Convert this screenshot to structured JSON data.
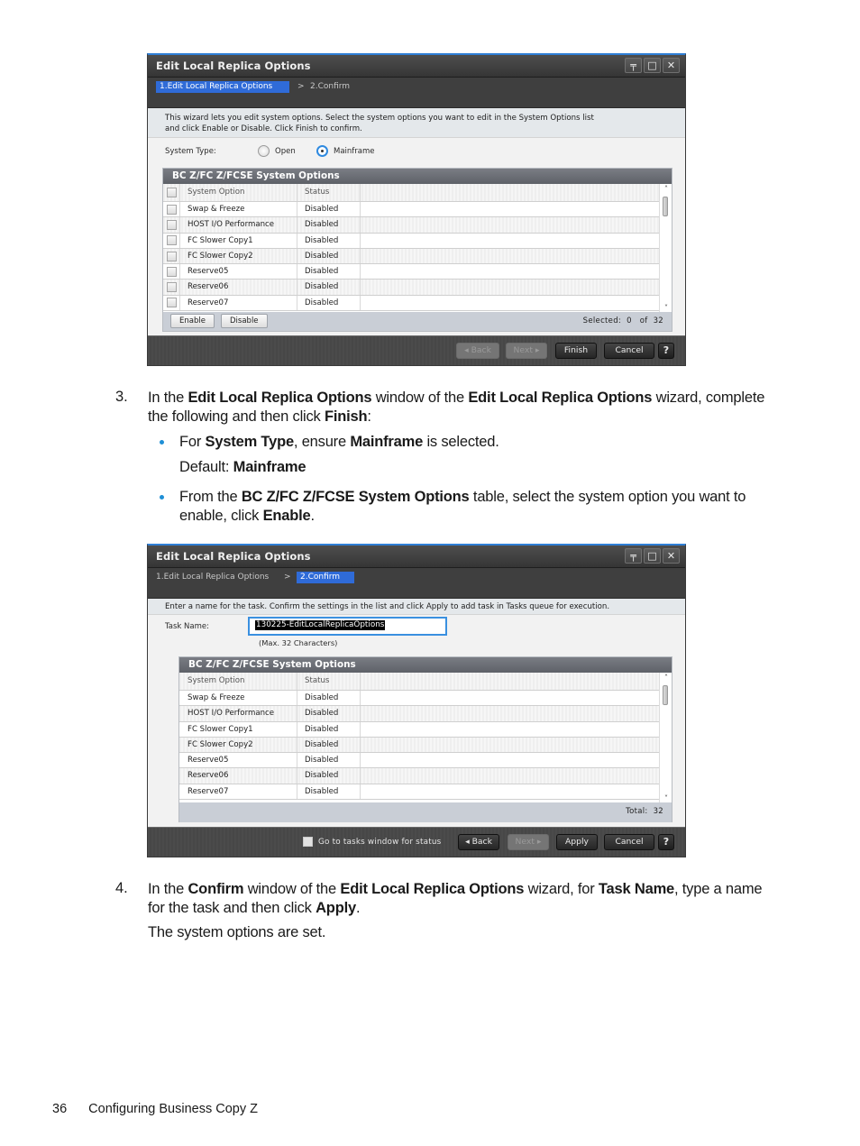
{
  "screens": {
    "edit": {
      "window_title": "Edit Local Replica Options",
      "window_buttons": [
        "pin-icon",
        "maximize-icon",
        "close-icon"
      ],
      "steps": [
        {
          "label": "1.Edit Local Replica Options",
          "active": true
        },
        {
          "label": "2.Confirm",
          "active": false
        }
      ],
      "step_separator": ">",
      "description_line1": "This wizard lets you edit system options. Select the system options you want to edit in the System Options list",
      "description_line2": "and click Enable or Disable. Click Finish to confirm.",
      "system_type_label": "System Type:",
      "system_type_options": [
        {
          "label": "Open",
          "selected": false
        },
        {
          "label": "Mainframe",
          "selected": true
        }
      ],
      "table_title": "BC Z/FC Z/FCSE System Options",
      "columns": [
        "System Option",
        "Status"
      ],
      "rows": [
        {
          "option": "Swap & Freeze",
          "status": "Disabled"
        },
        {
          "option": "HOST I/O Performance",
          "status": "Disabled"
        },
        {
          "option": "FC Slower Copy1",
          "status": "Disabled"
        },
        {
          "option": "FC Slower Copy2",
          "status": "Disabled"
        },
        {
          "option": "Reserve05",
          "status": "Disabled"
        },
        {
          "option": "Reserve06",
          "status": "Disabled"
        },
        {
          "option": "Reserve07",
          "status": "Disabled"
        }
      ],
      "enable_label": "Enable",
      "disable_label": "Disable",
      "selected_text": "Selected:  0   of  32",
      "footer_buttons": {
        "back": "Back",
        "next": "Next",
        "finish": "Finish",
        "cancel": "Cancel",
        "help": "?"
      }
    },
    "confirm": {
      "window_title": "Edit Local Replica Options",
      "steps": [
        {
          "label": "1.Edit Local Replica Options",
          "active": false
        },
        {
          "label": "2.Confirm",
          "active": true
        }
      ],
      "step_separator": ">",
      "description": "Enter a name for the task. Confirm the settings in the list and click Apply to add task in Tasks queue for execution.",
      "task_name_label": "Task Name:",
      "task_name_value": "130225-EditLocalReplicaOptions",
      "task_name_hint": "(Max. 32 Characters)",
      "table_title": "BC Z/FC Z/FCSE System Options",
      "columns": [
        "System Option",
        "Status"
      ],
      "rows": [
        {
          "option": "Swap & Freeze",
          "status": "Disabled"
        },
        {
          "option": "HOST I/O Performance",
          "status": "Disabled"
        },
        {
          "option": "FC Slower Copy1",
          "status": "Disabled"
        },
        {
          "option": "FC Slower Copy2",
          "status": "Disabled"
        },
        {
          "option": "Reserve05",
          "status": "Disabled"
        },
        {
          "option": "Reserve06",
          "status": "Disabled"
        },
        {
          "option": "Reserve07",
          "status": "Disabled"
        }
      ],
      "total_text": "Total:  32",
      "go_status_label": "Go to tasks window for status",
      "footer_buttons": {
        "back": "Back",
        "next": "Next",
        "apply": "Apply",
        "cancel": "Cancel",
        "help": "?"
      }
    }
  },
  "doc": {
    "step3": {
      "number": "3.",
      "line1_parts": [
        "In the ",
        "Edit Local Replica Options",
        " window of the ",
        "Edit Local Replica Options",
        " wizard, complete"
      ],
      "line2_parts": [
        "the following and then click ",
        "Finish",
        ":"
      ],
      "bullet1_parts": [
        "For ",
        "System Type",
        ", ensure ",
        "Mainframe",
        " is selected."
      ],
      "default_parts": [
        "Default: ",
        "Mainframe"
      ],
      "bullet2_line1_parts": [
        "From the ",
        "BC Z/FC Z/FCSE System Options",
        " table, select the system option you want to"
      ],
      "bullet2_line2_parts": [
        "enable, click ",
        "Enable",
        "."
      ]
    },
    "step4": {
      "number": "4.",
      "line1_parts": [
        "In the ",
        "Confirm",
        " window of the ",
        "Edit Local Replica Options",
        " wizard, for ",
        "Task Name",
        ", type a name"
      ],
      "line2_parts": [
        "for the task and then click ",
        "Apply",
        "."
      ],
      "result": "The system options are set."
    }
  },
  "page_footer": {
    "page_number": "36",
    "section": "Configuring Business Copy Z"
  },
  "colors": {
    "accent_blue": "#2f6bd8",
    "bullet_blue": "#1e8fd6",
    "window_dark": "#3f3f3f"
  }
}
